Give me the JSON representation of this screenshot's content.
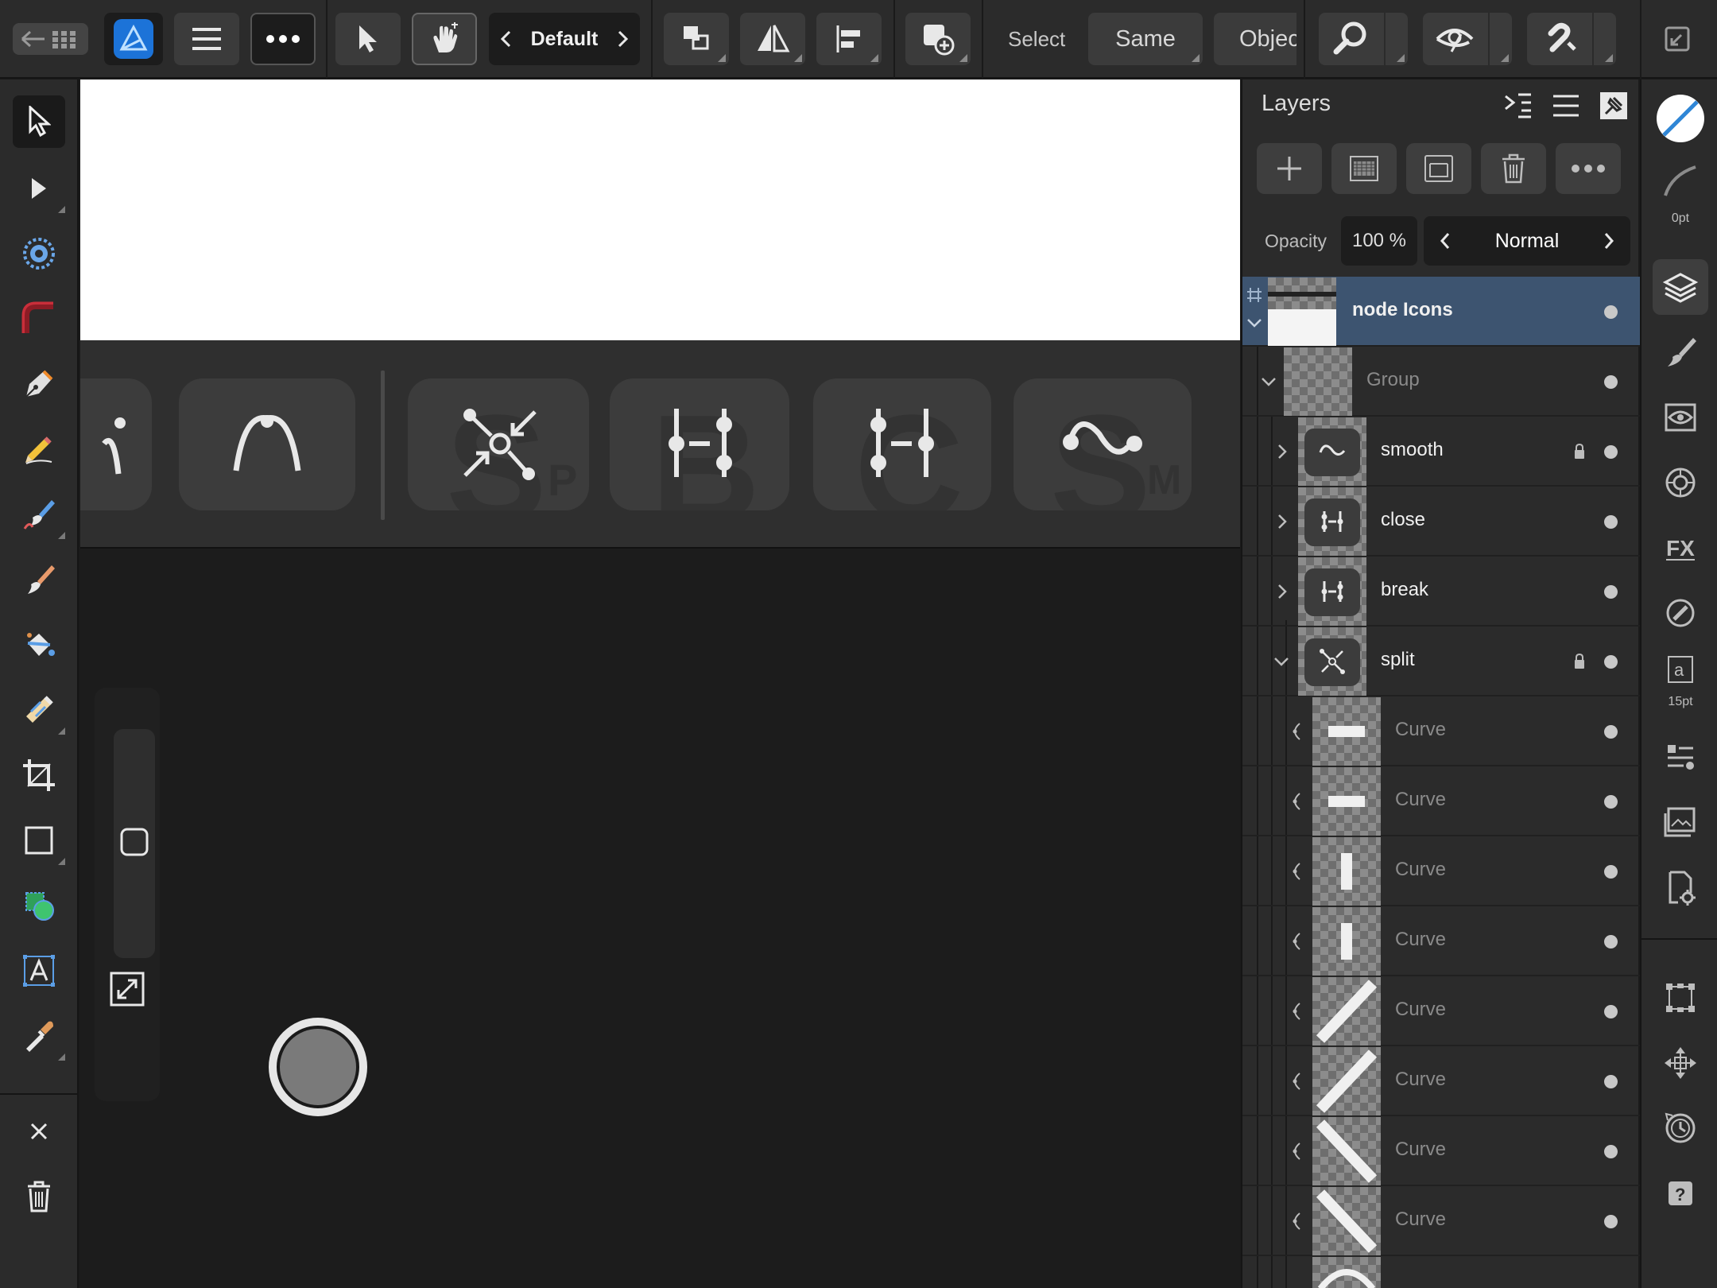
{
  "topbar": {
    "studio_preset": "Default",
    "select_label": "Select",
    "same_label": "Same",
    "object_label": "Objec"
  },
  "layers_panel": {
    "title": "Layers",
    "opacity_label": "Opacity",
    "opacity_value": "100 %",
    "blend_mode": "Normal",
    "rows": [
      {
        "name": "node Icons",
        "selected": true,
        "locked": false
      },
      {
        "name": "Group",
        "selected": false,
        "locked": false
      },
      {
        "name": "smooth",
        "selected": false,
        "locked": true
      },
      {
        "name": "close",
        "selected": false,
        "locked": false
      },
      {
        "name": "break",
        "selected": false,
        "locked": false
      },
      {
        "name": "split",
        "selected": false,
        "locked": true
      },
      {
        "name": "Curve"
      },
      {
        "name": "Curve"
      },
      {
        "name": "Curve"
      },
      {
        "name": "Curve"
      },
      {
        "name": "Curve"
      },
      {
        "name": "Curve"
      },
      {
        "name": "Curve"
      },
      {
        "name": "Curve"
      }
    ]
  },
  "rightstrip": {
    "stroke_width": "0pt",
    "font_size": "15pt"
  },
  "canvas": {
    "ghost_letters": [
      "S",
      "P",
      "B",
      "C",
      "S",
      "M"
    ]
  },
  "icons": {
    "app": "affinity-designer-icon",
    "selection": "node-selection-icon"
  }
}
